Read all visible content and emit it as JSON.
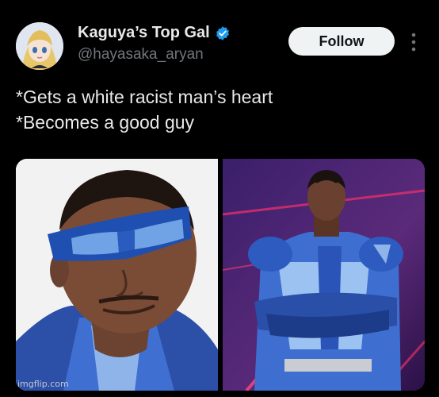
{
  "author": {
    "display_name": "Kaguya’s Top Gal",
    "handle": "@hayasaka_aryan",
    "verified": true
  },
  "actions": {
    "follow_label": "Follow",
    "more_icon": "more-vertical-icon"
  },
  "tweet": {
    "lines": [
      "*Gets a white racist man’s heart",
      "*Becomes a good guy"
    ]
  },
  "media": {
    "images": [
      "close-up of a man in blue visor glasses",
      "man in blue superhero suit with crossed arms"
    ]
  },
  "watermark": "imgflip.com",
  "colors": {
    "background": "#000000",
    "text": "#e7e9ea",
    "secondary_text": "#71767b",
    "verified_blue": "#1d9bf0",
    "follow_bg": "#eff3f4"
  }
}
